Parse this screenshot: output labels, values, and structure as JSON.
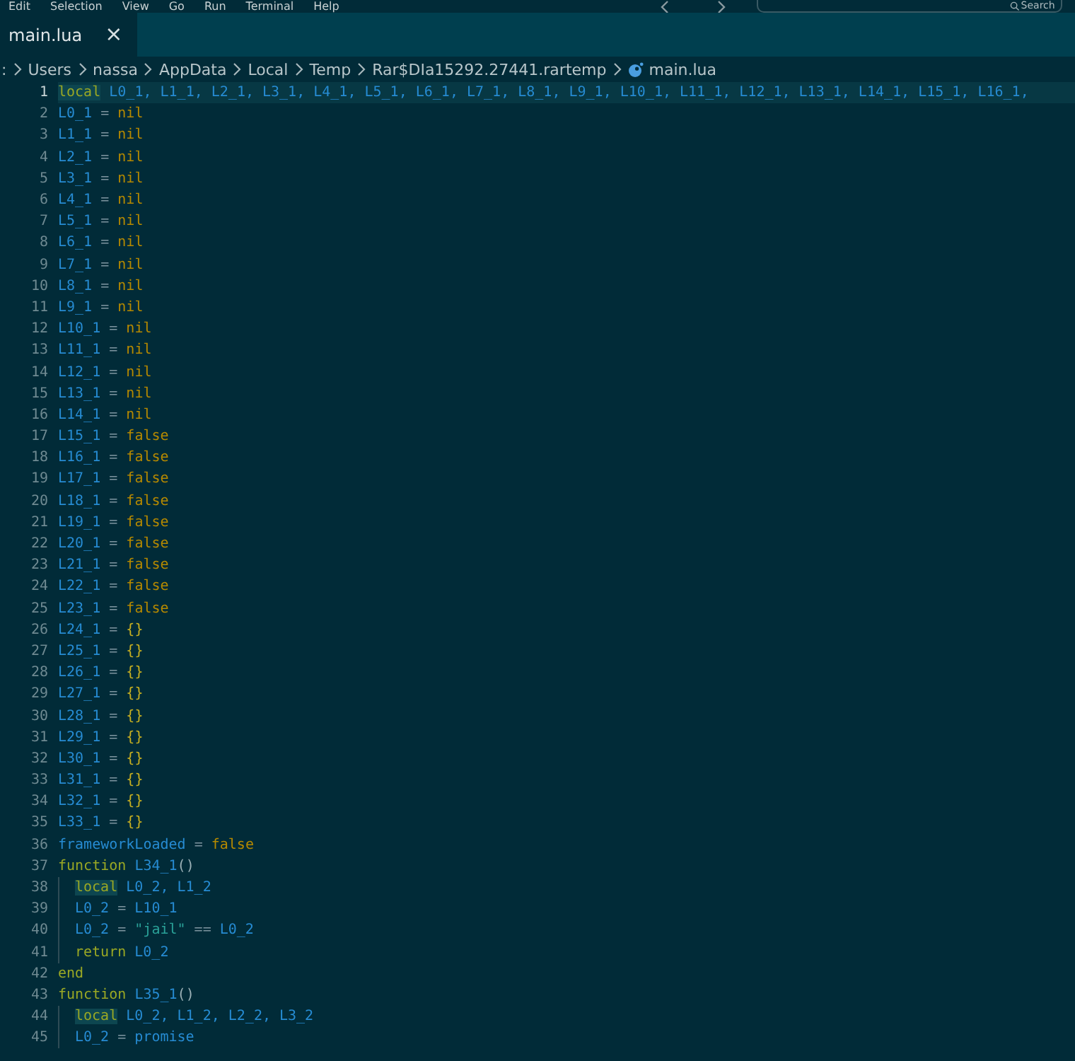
{
  "menu_bar": {
    "items": [
      "Edit",
      "Selection",
      "View",
      "Go",
      "Run",
      "Terminal",
      "Help"
    ],
    "search": {
      "placeholder": "Search"
    }
  },
  "tabs": [
    {
      "label": "main.lua",
      "selected": true,
      "close": "×"
    }
  ],
  "breadcrumb": [
    ":",
    "Users",
    "nassa",
    "AppData",
    "Local",
    "Temp",
    "Rar$DIa15292.27441.rartemp",
    "main.lua"
  ],
  "editor": {
    "lines": [
      {
        "number": "1",
        "current": true,
        "tokens": [
          {
            "kind": "kw",
            "text": "local",
            "highlighted": true
          },
          {
            "kind": "var",
            "text": " L0_1, L1_1, L2_1, L3_1, L4_1, L5_1, L6_1, L7_1, L8_1, L9_1, L10_1, L11_1, L12_1, L13_1, L14_1, L15_1, L16_1,"
          }
        ]
      },
      {
        "number": "2",
        "current": false,
        "tokens": [
          {
            "kind": "var",
            "text": "L0_1"
          },
          {
            "kind": "op",
            "text": " = "
          },
          {
            "kind": "lit",
            "text": "nil"
          }
        ]
      },
      {
        "number": "3",
        "current": false,
        "tokens": [
          {
            "kind": "var",
            "text": "L1_1"
          },
          {
            "kind": "op",
            "text": " = "
          },
          {
            "kind": "lit",
            "text": "nil"
          }
        ]
      },
      {
        "number": "4",
        "current": false,
        "tokens": [
          {
            "kind": "var",
            "text": "L2_1"
          },
          {
            "kind": "op",
            "text": " = "
          },
          {
            "kind": "lit",
            "text": "nil"
          }
        ]
      },
      {
        "number": "5",
        "current": false,
        "tokens": [
          {
            "kind": "var",
            "text": "L3_1"
          },
          {
            "kind": "op",
            "text": " = "
          },
          {
            "kind": "lit",
            "text": "nil"
          }
        ]
      },
      {
        "number": "6",
        "current": false,
        "tokens": [
          {
            "kind": "var",
            "text": "L4_1"
          },
          {
            "kind": "op",
            "text": " = "
          },
          {
            "kind": "lit",
            "text": "nil"
          }
        ]
      },
      {
        "number": "7",
        "current": false,
        "tokens": [
          {
            "kind": "var",
            "text": "L5_1"
          },
          {
            "kind": "op",
            "text": " = "
          },
          {
            "kind": "lit",
            "text": "nil"
          }
        ]
      },
      {
        "number": "8",
        "current": false,
        "tokens": [
          {
            "kind": "var",
            "text": "L6_1"
          },
          {
            "kind": "op",
            "text": " = "
          },
          {
            "kind": "lit",
            "text": "nil"
          }
        ]
      },
      {
        "number": "9",
        "current": false,
        "tokens": [
          {
            "kind": "var",
            "text": "L7_1"
          },
          {
            "kind": "op",
            "text": " = "
          },
          {
            "kind": "lit",
            "text": "nil"
          }
        ]
      },
      {
        "number": "10",
        "current": false,
        "tokens": [
          {
            "kind": "var",
            "text": "L8_1"
          },
          {
            "kind": "op",
            "text": " = "
          },
          {
            "kind": "lit",
            "text": "nil"
          }
        ]
      },
      {
        "number": "11",
        "current": false,
        "tokens": [
          {
            "kind": "var",
            "text": "L9_1"
          },
          {
            "kind": "op",
            "text": " = "
          },
          {
            "kind": "lit",
            "text": "nil"
          }
        ]
      },
      {
        "number": "12",
        "current": false,
        "tokens": [
          {
            "kind": "var",
            "text": "L10_1"
          },
          {
            "kind": "op",
            "text": " = "
          },
          {
            "kind": "lit",
            "text": "nil"
          }
        ]
      },
      {
        "number": "13",
        "current": false,
        "tokens": [
          {
            "kind": "var",
            "text": "L11_1"
          },
          {
            "kind": "op",
            "text": " = "
          },
          {
            "kind": "lit",
            "text": "nil"
          }
        ]
      },
      {
        "number": "14",
        "current": false,
        "tokens": [
          {
            "kind": "var",
            "text": "L12_1"
          },
          {
            "kind": "op",
            "text": " = "
          },
          {
            "kind": "lit",
            "text": "nil"
          }
        ]
      },
      {
        "number": "15",
        "current": false,
        "tokens": [
          {
            "kind": "var",
            "text": "L13_1"
          },
          {
            "kind": "op",
            "text": " = "
          },
          {
            "kind": "lit",
            "text": "nil"
          }
        ]
      },
      {
        "number": "16",
        "current": false,
        "tokens": [
          {
            "kind": "var",
            "text": "L14_1"
          },
          {
            "kind": "op",
            "text": " = "
          },
          {
            "kind": "lit",
            "text": "nil"
          }
        ]
      },
      {
        "number": "17",
        "current": false,
        "tokens": [
          {
            "kind": "var",
            "text": "L15_1"
          },
          {
            "kind": "op",
            "text": " = "
          },
          {
            "kind": "lit",
            "text": "false"
          }
        ]
      },
      {
        "number": "18",
        "current": false,
        "tokens": [
          {
            "kind": "var",
            "text": "L16_1"
          },
          {
            "kind": "op",
            "text": " = "
          },
          {
            "kind": "lit",
            "text": "false"
          }
        ]
      },
      {
        "number": "19",
        "current": false,
        "tokens": [
          {
            "kind": "var",
            "text": "L17_1"
          },
          {
            "kind": "op",
            "text": " = "
          },
          {
            "kind": "lit",
            "text": "false"
          }
        ]
      },
      {
        "number": "20",
        "current": false,
        "tokens": [
          {
            "kind": "var",
            "text": "L18_1"
          },
          {
            "kind": "op",
            "text": " = "
          },
          {
            "kind": "lit",
            "text": "false"
          }
        ]
      },
      {
        "number": "21",
        "current": false,
        "tokens": [
          {
            "kind": "var",
            "text": "L19_1"
          },
          {
            "kind": "op",
            "text": " = "
          },
          {
            "kind": "lit",
            "text": "false"
          }
        ]
      },
      {
        "number": "22",
        "current": false,
        "tokens": [
          {
            "kind": "var",
            "text": "L20_1"
          },
          {
            "kind": "op",
            "text": " = "
          },
          {
            "kind": "lit",
            "text": "false"
          }
        ]
      },
      {
        "number": "23",
        "current": false,
        "tokens": [
          {
            "kind": "var",
            "text": "L21_1"
          },
          {
            "kind": "op",
            "text": " = "
          },
          {
            "kind": "lit",
            "text": "false"
          }
        ]
      },
      {
        "number": "24",
        "current": false,
        "tokens": [
          {
            "kind": "var",
            "text": "L22_1"
          },
          {
            "kind": "op",
            "text": " = "
          },
          {
            "kind": "lit",
            "text": "false"
          }
        ]
      },
      {
        "number": "25",
        "current": false,
        "tokens": [
          {
            "kind": "var",
            "text": "L23_1"
          },
          {
            "kind": "op",
            "text": " = "
          },
          {
            "kind": "lit",
            "text": "false"
          }
        ]
      },
      {
        "number": "26",
        "current": false,
        "tokens": [
          {
            "kind": "var",
            "text": "L24_1"
          },
          {
            "kind": "op",
            "text": " = "
          },
          {
            "kind": "brace",
            "text": "{}"
          }
        ]
      },
      {
        "number": "27",
        "current": false,
        "tokens": [
          {
            "kind": "var",
            "text": "L25_1"
          },
          {
            "kind": "op",
            "text": " = "
          },
          {
            "kind": "brace",
            "text": "{}"
          }
        ]
      },
      {
        "number": "28",
        "current": false,
        "tokens": [
          {
            "kind": "var",
            "text": "L26_1"
          },
          {
            "kind": "op",
            "text": " = "
          },
          {
            "kind": "brace",
            "text": "{}"
          }
        ]
      },
      {
        "number": "29",
        "current": false,
        "tokens": [
          {
            "kind": "var",
            "text": "L27_1"
          },
          {
            "kind": "op",
            "text": " = "
          },
          {
            "kind": "brace",
            "text": "{}"
          }
        ]
      },
      {
        "number": "30",
        "current": false,
        "tokens": [
          {
            "kind": "var",
            "text": "L28_1"
          },
          {
            "kind": "op",
            "text": " = "
          },
          {
            "kind": "brace",
            "text": "{}"
          }
        ]
      },
      {
        "number": "31",
        "current": false,
        "tokens": [
          {
            "kind": "var",
            "text": "L29_1"
          },
          {
            "kind": "op",
            "text": " = "
          },
          {
            "kind": "brace",
            "text": "{}"
          }
        ]
      },
      {
        "number": "32",
        "current": false,
        "tokens": [
          {
            "kind": "var",
            "text": "L30_1"
          },
          {
            "kind": "op",
            "text": " = "
          },
          {
            "kind": "brace",
            "text": "{}"
          }
        ]
      },
      {
        "number": "33",
        "current": false,
        "tokens": [
          {
            "kind": "var",
            "text": "L31_1"
          },
          {
            "kind": "op",
            "text": " = "
          },
          {
            "kind": "brace",
            "text": "{}"
          }
        ]
      },
      {
        "number": "34",
        "current": false,
        "tokens": [
          {
            "kind": "var",
            "text": "L32_1"
          },
          {
            "kind": "op",
            "text": " = "
          },
          {
            "kind": "brace",
            "text": "{}"
          }
        ]
      },
      {
        "number": "35",
        "current": false,
        "tokens": [
          {
            "kind": "var",
            "text": "L33_1"
          },
          {
            "kind": "op",
            "text": " = "
          },
          {
            "kind": "brace",
            "text": "{}"
          }
        ]
      },
      {
        "number": "36",
        "current": false,
        "tokens": [
          {
            "kind": "var",
            "text": "frameworkLoaded"
          },
          {
            "kind": "op",
            "text": " = "
          },
          {
            "kind": "lit",
            "text": "false"
          }
        ]
      },
      {
        "number": "37",
        "current": false,
        "tokens": [
          {
            "kind": "kw",
            "text": "function",
            "highlighted": false
          },
          {
            "kind": "var",
            "text": " L34_1"
          },
          {
            "kind": "paren",
            "text": "()"
          }
        ],
        "children": [
          {
            "number": "38",
            "current": false,
            "tokens": [
              {
                "kind": "kw",
                "text": "local",
                "highlighted": true
              },
              {
                "kind": "var",
                "text": " L0_2, L1_2"
              }
            ]
          },
          {
            "number": "39",
            "current": false,
            "tokens": [
              {
                "kind": "var",
                "text": "L0_2"
              },
              {
                "kind": "op",
                "text": " = "
              },
              {
                "kind": "var",
                "text": "L10_1"
              }
            ]
          },
          {
            "number": "40",
            "current": false,
            "tokens": [
              {
                "kind": "var",
                "text": "L0_2"
              },
              {
                "kind": "op",
                "text": " = "
              },
              {
                "kind": "str",
                "text": "\"jail\""
              },
              {
                "kind": "op",
                "text": " == "
              },
              {
                "kind": "var",
                "text": "L0_2"
              }
            ]
          },
          {
            "number": "41",
            "current": false,
            "tokens": [
              {
                "kind": "kw",
                "text": "return",
                "highlighted": false
              },
              {
                "kind": "var",
                "text": " L0_2"
              }
            ]
          }
        ]
      },
      {
        "number": "42",
        "current": false,
        "tokens": [
          {
            "kind": "kw",
            "text": "end",
            "highlighted": false
          }
        ]
      },
      {
        "number": "43",
        "current": false,
        "tokens": [
          {
            "kind": "kw",
            "text": "function",
            "highlighted": false
          },
          {
            "kind": "var",
            "text": " L35_1"
          },
          {
            "kind": "paren",
            "text": "()"
          }
        ],
        "children": [
          {
            "number": "44",
            "current": false,
            "tokens": [
              {
                "kind": "kw",
                "text": "local",
                "highlighted": true
              },
              {
                "kind": "var",
                "text": " L0_2, L1_2, L2_2, L3_2"
              }
            ]
          },
          {
            "number": "45",
            "current": false,
            "tokens": [
              {
                "kind": "var",
                "text": "L0_2"
              },
              {
                "kind": "op",
                "text": " = "
              },
              {
                "kind": "var",
                "text": "promise"
              }
            ]
          }
        ]
      }
    ]
  }
}
